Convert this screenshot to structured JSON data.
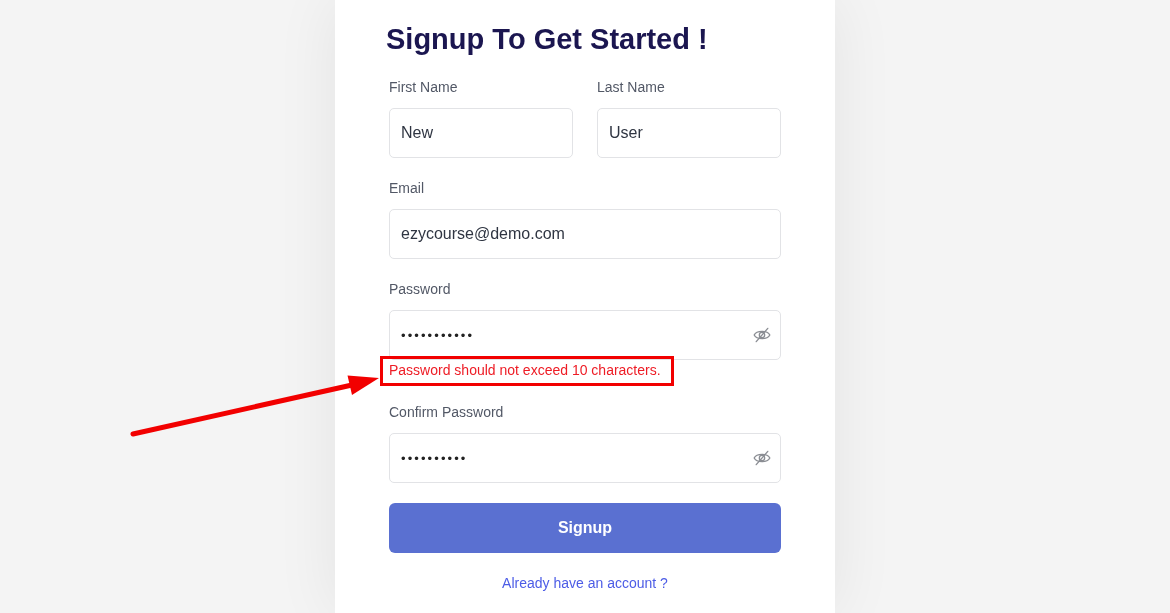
{
  "title": "Signup To Get Started !",
  "name_fields": [
    {
      "kind": "text",
      "label": "First Name",
      "value": "New"
    },
    {
      "kind": "text",
      "label": "Last Name",
      "value": "User"
    }
  ],
  "fields": [
    {
      "kind": "text",
      "label": "Email",
      "value": "ezycourse@demo.com"
    },
    {
      "kind": "password",
      "label": "Password",
      "value": "•••••••••••",
      "error": {
        "text": "Password should not exceed 10 characters.",
        "highlighted": true
      }
    },
    {
      "kind": "password",
      "label": "Confirm Password",
      "value": "••••••••••"
    }
  ],
  "submit_button": "Signup",
  "login_link": "Already have an account ?"
}
